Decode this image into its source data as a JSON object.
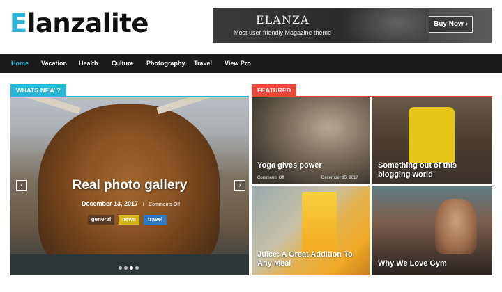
{
  "header": {
    "logo_first": "E",
    "logo_rest": "lanzalite",
    "banner": {
      "title": "ELANZA",
      "subtitle": "Most user friendly Magazine theme",
      "button_label": "Buy Now ›"
    }
  },
  "nav": {
    "items": [
      {
        "label": "Home",
        "active": true
      },
      {
        "label": "Vacation",
        "active": false
      },
      {
        "label": "Health",
        "active": false
      },
      {
        "label": "Culture",
        "active": false
      },
      {
        "label": "Photography",
        "active": false
      },
      {
        "label": "Travel",
        "active": false
      },
      {
        "label": "View Pro",
        "active": false
      }
    ]
  },
  "sections": {
    "whats_new": "WHATS NEW ?",
    "featured": "FEATURED"
  },
  "slider": {
    "title": "Real photo gallery",
    "date": "December 13, 2017",
    "separator": "/",
    "comments": "Comments Off",
    "tags": [
      {
        "label": "general",
        "color": "#5a3a22"
      },
      {
        "label": "news",
        "color": "#d2b41a"
      },
      {
        "label": "travel",
        "color": "#2b7ac3"
      }
    ],
    "prev_label": "‹",
    "next_label": "›",
    "active_dot": 3,
    "dot_count": 4
  },
  "featured": {
    "tiles": [
      {
        "title": "Yoga gives power",
        "comments": "Comments Off",
        "date": "December 15, 2017"
      },
      {
        "title": "Something out of this blogging world"
      },
      {
        "title": "Juice: A Great Addition To Any Meal"
      },
      {
        "title": "Why We Love Gym"
      }
    ]
  },
  "colors": {
    "accent": "#2bb6d8",
    "featured": "#e8473a",
    "nav_bg": "#1a1a1a"
  }
}
